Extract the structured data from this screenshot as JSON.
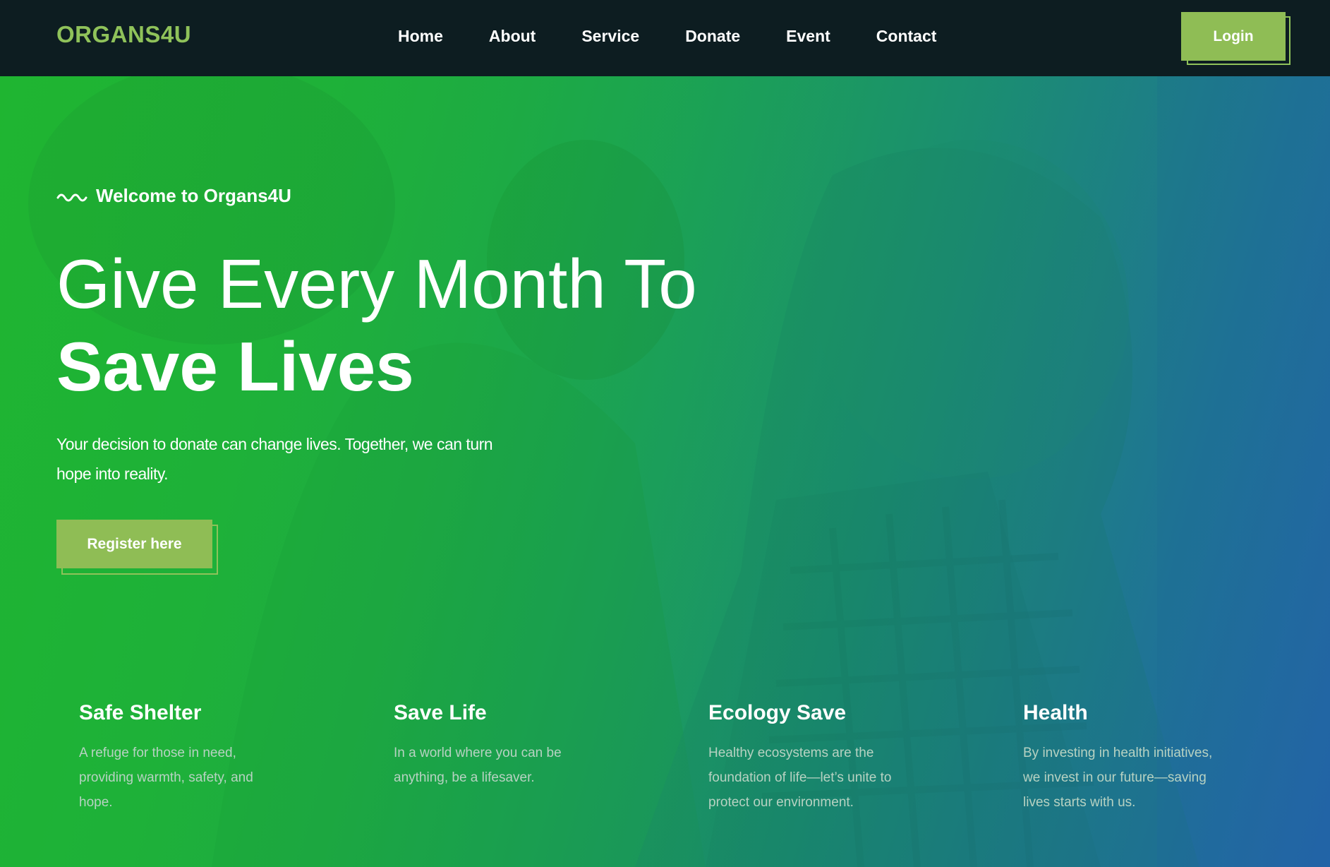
{
  "brand": {
    "logo_text": "ORGANS4U",
    "accent_color": "#8fbd55"
  },
  "nav": {
    "items": [
      {
        "label": "Home"
      },
      {
        "label": "About"
      },
      {
        "label": "Service"
      },
      {
        "label": "Donate"
      },
      {
        "label": "Event"
      },
      {
        "label": "Contact"
      }
    ],
    "login_label": "Login"
  },
  "hero": {
    "welcome_icon": "wave-icon",
    "welcome_text": "Welcome to Organs4U",
    "headline_line1": "Give Every Month To",
    "headline_line2": "Save Lives",
    "description": "Your decision to donate can change lives. Together, we can turn hope into reality.",
    "cta_label": "Register here"
  },
  "features": [
    {
      "title": "Safe Shelter",
      "text": "A refuge for those in need, providing warmth, safety, and hope."
    },
    {
      "title": "Save Life",
      "text": "In a world where you can be anything, be a lifesaver."
    },
    {
      "title": "Ecology Save",
      "text": "Healthy ecosystems are the foundation of life—let’s unite to protect our environment."
    },
    {
      "title": "Health",
      "text": "By investing in health initiatives, we invest in our future—saving lives starts with us."
    }
  ]
}
